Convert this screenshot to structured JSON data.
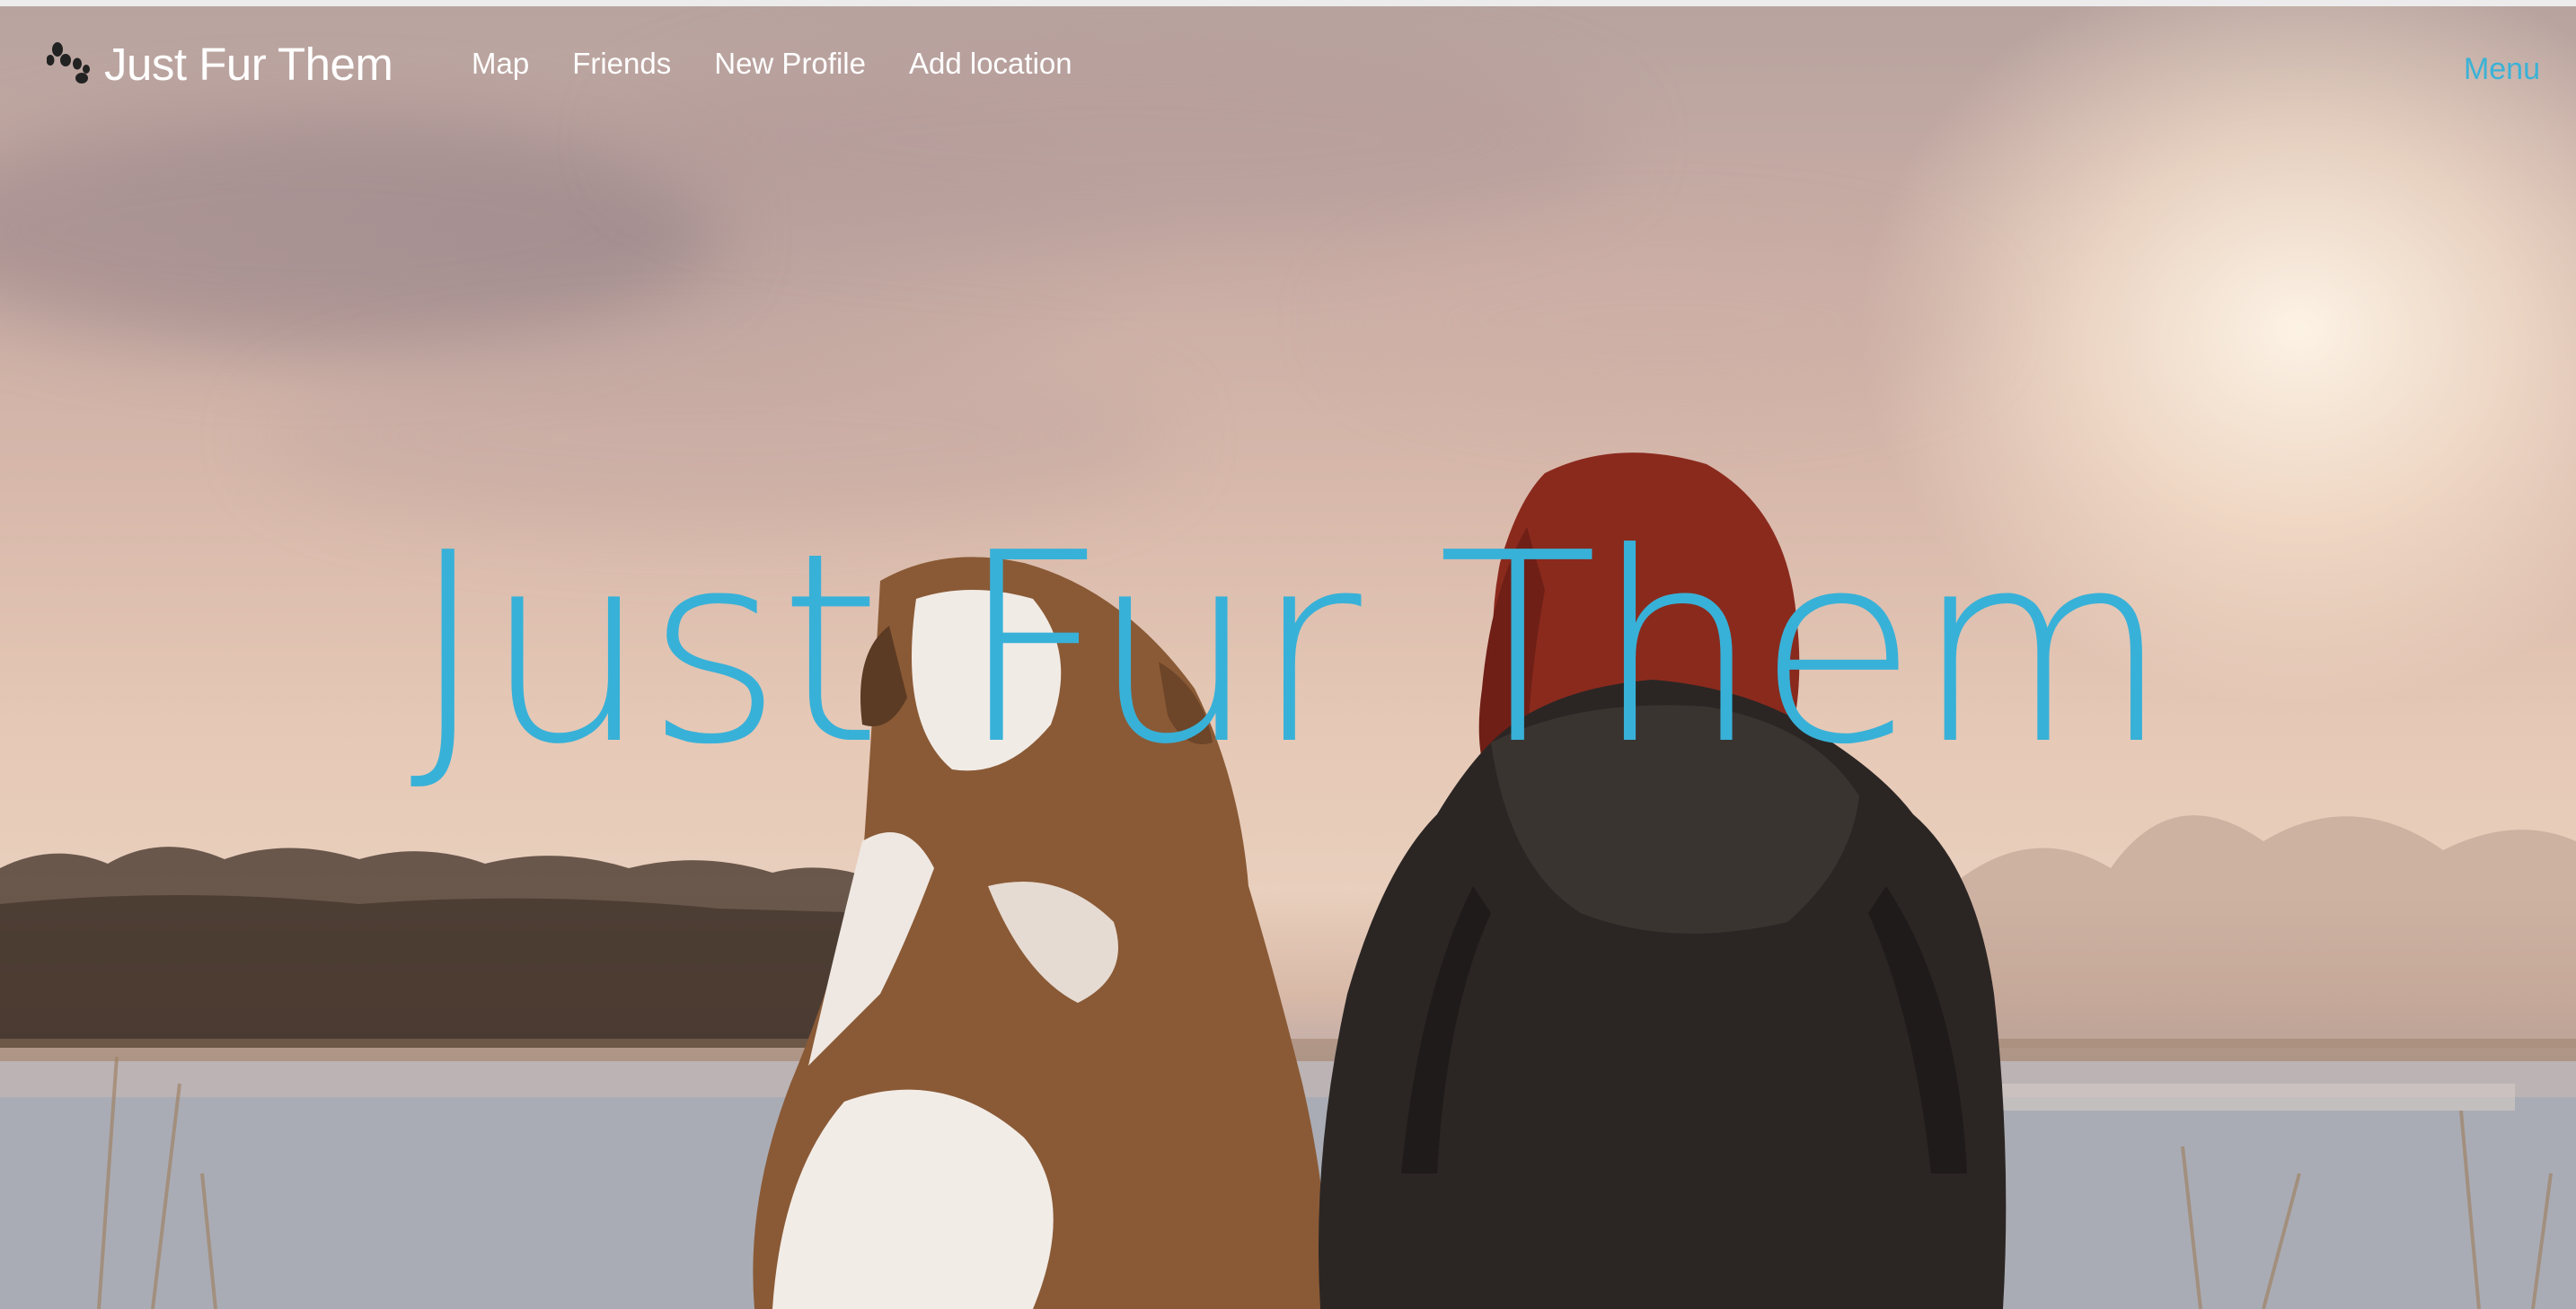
{
  "brand": {
    "name": "Just Fur Them",
    "icon": "paw-icon"
  },
  "nav": {
    "items": [
      {
        "label": "Map"
      },
      {
        "label": "Friends"
      },
      {
        "label": "New Profile"
      },
      {
        "label": "Add location"
      }
    ]
  },
  "menu": {
    "label": "Menu"
  },
  "hero": {
    "title": "Just Fur Them",
    "image": "hero-photo-dog-and-woman-by-lake"
  },
  "colors": {
    "accent": "#38b1d8",
    "nav_text": "#ffffff"
  }
}
